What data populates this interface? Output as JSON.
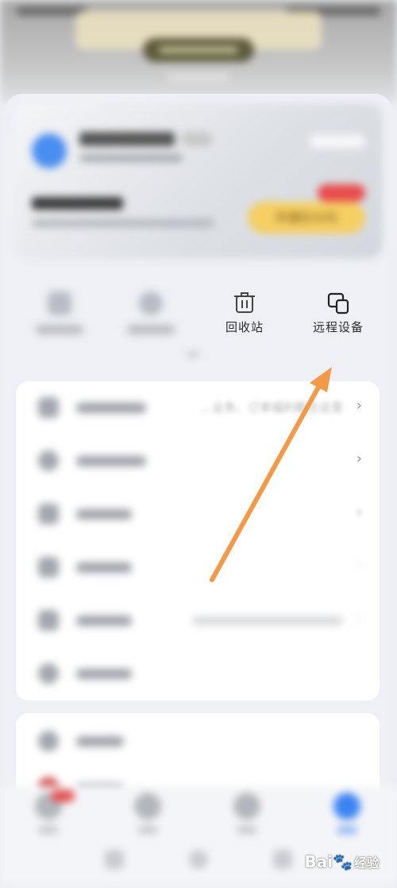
{
  "account_card": {
    "open_vip_label": "开通仅10元"
  },
  "quick_actions": [
    {
      "label": "",
      "icon": "download-icon"
    },
    {
      "label": "",
      "icon": "clock-icon"
    },
    {
      "label": "回收站",
      "icon": "trash-icon"
    },
    {
      "label": "远程设备",
      "icon": "remote-devices-icon"
    }
  ],
  "menu": {
    "rows": [
      {
        "label": "",
        "promo": "…业务、订单福利都在这里",
        "icon": "card-icon"
      },
      {
        "label": "",
        "promo": "",
        "icon": "gift-icon"
      },
      {
        "label": "",
        "promo": "",
        "icon": "bag-icon"
      },
      {
        "label": "",
        "promo": "",
        "icon": "video-icon"
      },
      {
        "label": "",
        "promo": "",
        "icon": "settings-icon"
      },
      {
        "label": "",
        "promo": "",
        "icon": "help-icon"
      }
    ],
    "chevron": "›"
  },
  "watermark": {
    "brand": "Bai",
    "suffix": "经验"
  },
  "colors": {
    "arrow": "#f39a4a",
    "accent": "#3d83f2",
    "vip_button": "#f6cf63"
  }
}
